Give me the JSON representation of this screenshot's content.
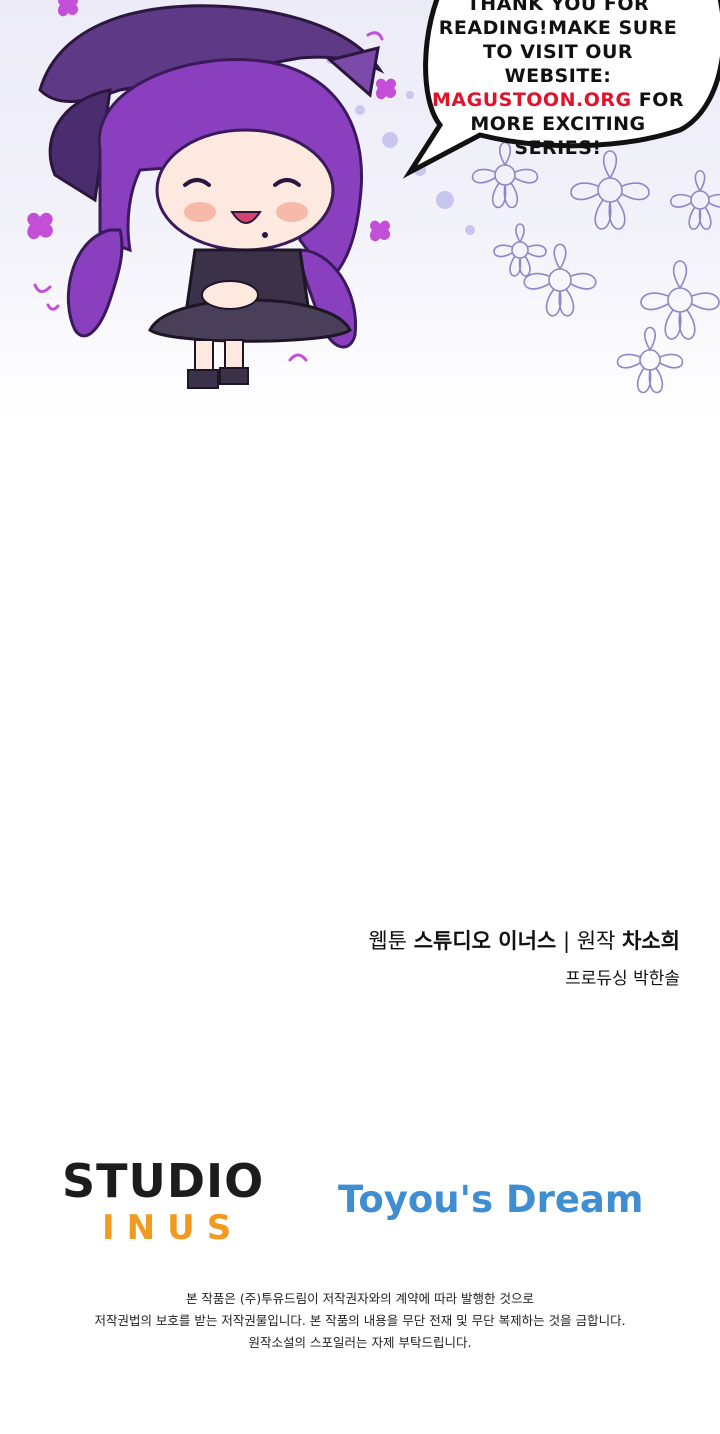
{
  "speech_bubble": {
    "line1": "THANK YOU FOR",
    "line2": "READING!MAKE SURE",
    "line3": "TO VISIT OUR WEBSITE:",
    "link": "MAGUSTOON.ORG",
    "line4_suffix": " FOR",
    "line5": "MORE EXCITING",
    "line6": "SERIES!"
  },
  "credits": {
    "webtoon_label": "웹툰",
    "webtoon_name": "스튜디오 이너스",
    "separator": "|",
    "original_label": "원작",
    "original_name": "차소희",
    "producing_label": "프로듀싱",
    "producing_name": "박한솔"
  },
  "logos": {
    "studio_top": "STUDIO",
    "studio_bottom": "INUS",
    "toyou": "Toyou's Dream"
  },
  "notice": {
    "line1": "본 작품은 (주)투유드림이 저작권자와의 계약에 따라 발행한 것으로",
    "line2": "저작권법의 보호를 받는 저작권물입니다. 본 작품의 내용을 무단 전재 및 무단 복제하는 것을 금합니다.",
    "line3": "원작소설의 스포일러는 자제 부탁드립니다."
  },
  "colors": {
    "link_red": "#e0132b",
    "studio_orange": "#f29a1f",
    "toyou_blue": "#3f8ed1",
    "hair_purple": "#8a3fbf"
  }
}
